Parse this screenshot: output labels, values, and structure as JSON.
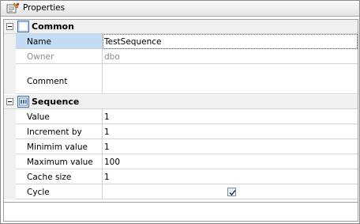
{
  "panel": {
    "title": "Properties"
  },
  "categories": {
    "common": {
      "label": "Common",
      "rows": {
        "name": {
          "label": "Name",
          "value": "TestSequence"
        },
        "owner": {
          "label": "Owner",
          "value": "dbo"
        },
        "comment": {
          "label": "Comment",
          "value": ""
        }
      }
    },
    "sequence": {
      "label": "Sequence",
      "rows": {
        "value": {
          "label": "Value",
          "value": "1"
        },
        "increment": {
          "label": "Increment by",
          "value": "1"
        },
        "minimum": {
          "label": "Minimim value",
          "value": "1"
        },
        "maximum": {
          "label": "Maximum value",
          "value": "100"
        },
        "cache": {
          "label": "Cache size",
          "value": "1"
        },
        "cycle": {
          "label": "Cycle",
          "checked": true
        }
      }
    }
  }
}
